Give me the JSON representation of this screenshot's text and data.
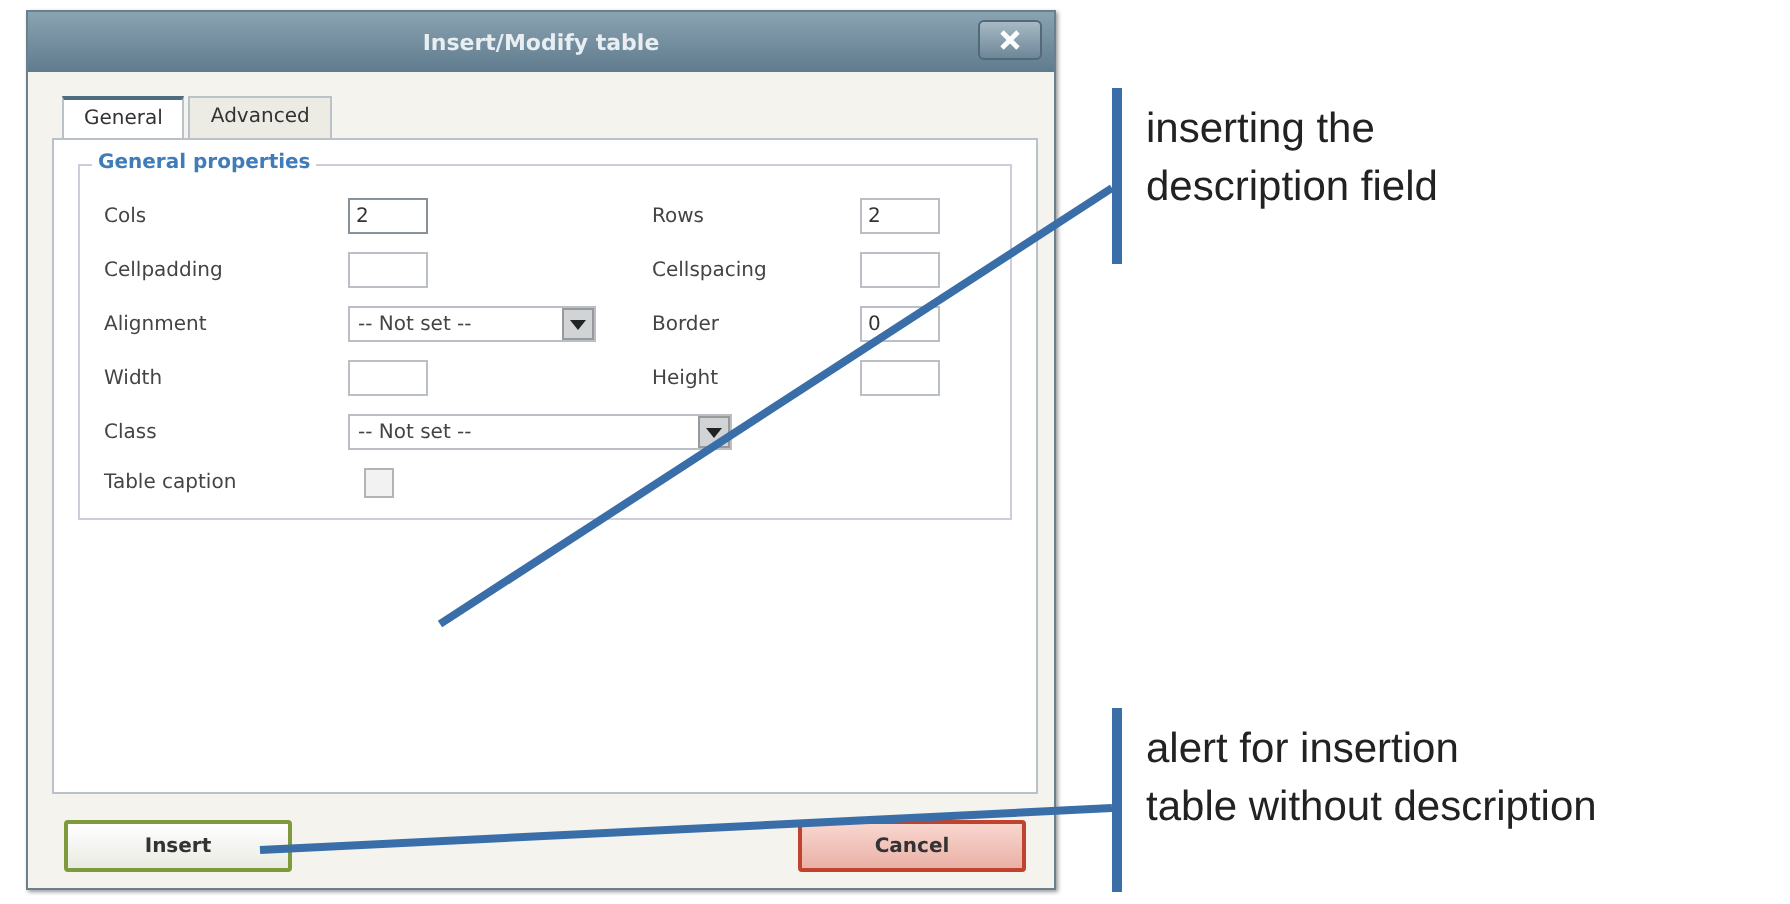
{
  "window": {
    "title": "Insert/Modify table"
  },
  "tabs": [
    {
      "label": "General",
      "selected": true
    },
    {
      "label": "Advanced",
      "selected": false
    }
  ],
  "fieldset": {
    "legend": "General properties",
    "rows": [
      {
        "fields": [
          {
            "label": "Cols",
            "kind": "text",
            "value": "2",
            "focused": true
          },
          {
            "label": "Rows",
            "kind": "text",
            "value": "2",
            "focused": false
          }
        ]
      },
      {
        "fields": [
          {
            "label": "Cellpadding",
            "kind": "text",
            "focused": false
          },
          {
            "label": "Cellspacing",
            "kind": "text",
            "focused": false
          }
        ]
      },
      {
        "fields": [
          {
            "label": "Alignment",
            "kind": "select",
            "value": "-- Not set --"
          },
          {
            "label": "Border",
            "kind": "text",
            "value": "0",
            "focused": false
          }
        ]
      },
      {
        "fields": [
          {
            "label": "Width",
            "kind": "text",
            "focused": false
          },
          {
            "label": "Height",
            "kind": "text",
            "focused": false
          }
        ]
      },
      {
        "fields": [
          {
            "label": "Class",
            "kind": "wideselect",
            "value": "-- Not set --"
          }
        ]
      },
      {
        "fields": [
          {
            "label": "Table caption",
            "kind": "checkbox",
            "checked": false
          }
        ]
      }
    ]
  },
  "buttons": [
    {
      "label": "Insert",
      "kind": "primary"
    },
    {
      "label": "Cancel",
      "kind": "cancel"
    }
  ],
  "annotations": [
    {
      "lines": [
        "inserting the",
        "description field"
      ]
    },
    {
      "lines": [
        "alert for insertion",
        "table without description"
      ]
    }
  ]
}
